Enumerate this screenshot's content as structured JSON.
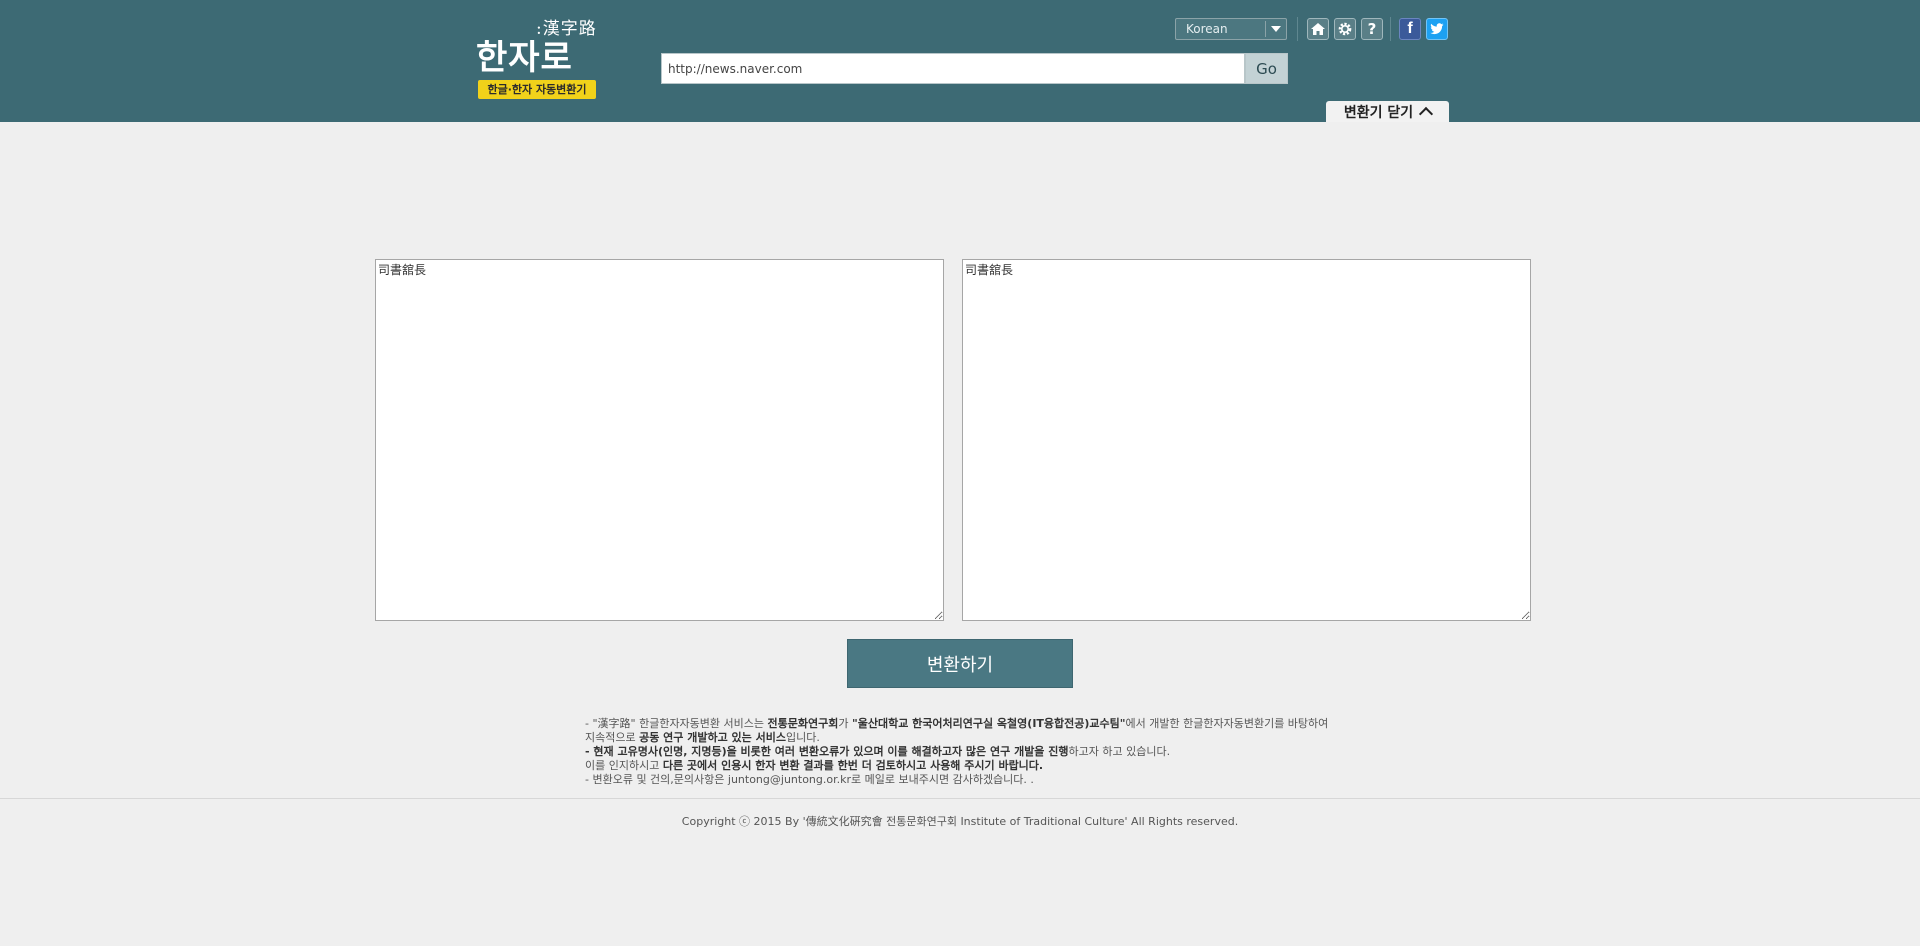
{
  "logo": {
    "hanja": ":漢字路",
    "hangul": "한자로",
    "tagline": "한글·한자 자동변환기"
  },
  "language": {
    "selected": "Korean"
  },
  "icons": {
    "home": "home-icon",
    "settings": "gear-icon",
    "help": "help-icon",
    "facebook": "facebook-icon",
    "twitter": "twitter-icon"
  },
  "url": {
    "value": "http://news.naver.com",
    "go_label": "Go"
  },
  "converter_toggle": {
    "label": "변환기 닫기"
  },
  "input_text": "司書舘長",
  "output_text": "司書舘長",
  "convert_label": "변환하기",
  "notice": {
    "line1_a": "- \"漢字路\" 한글한자자동변환 서비스는 ",
    "line1_b": "전통문화연구회",
    "line1_c": "가 ",
    "line1_d": "\"울산대학교 한국어처리연구실 옥철영(IT융합전공)교수팀\"",
    "line1_e": "에서 개발한 한글한자자동변환기를 바탕하여 지속적으로 ",
    "line1_f": "공동 연구 개발하고 있는 서비스",
    "line1_g": "입니다.",
    "line2_a": "- 현재 고유명사(인명, 지명등)을 비롯한 여러 변환오류가 있으며 이를 해결하고자 많은 연구 개발을 진행",
    "line2_b": "하고자 하고 있습니다.",
    "line3_a": "이를 인지하시고 ",
    "line3_b": "다른 곳에서 인용시 한자 변환 결과를 한번 더 검토하시고 사용해 주시기 바랍니다.",
    "line4": "- 변환오류 및 건의,문의사항은 juntong@juntong.or.kr로 메일로 보내주시면 감사하겠습니다. ."
  },
  "copyright": "Copyright ⓒ 2015 By '傳統文化硏究會 전통문화연구회 Institute of Traditional Culture' All Rights reserved."
}
